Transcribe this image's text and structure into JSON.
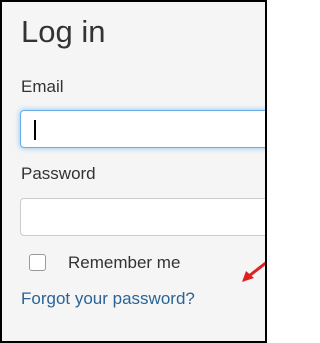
{
  "login": {
    "title": "Log in",
    "email_label": "Email",
    "email_value": "",
    "password_label": "Password",
    "password_value": "",
    "remember_label": "Remember me",
    "remember_checked": false,
    "forgot_link": "Forgot your password?"
  },
  "colors": {
    "annotation_arrow": "#e02020",
    "link": "#2a6496",
    "focus_ring": "#66afe9"
  }
}
